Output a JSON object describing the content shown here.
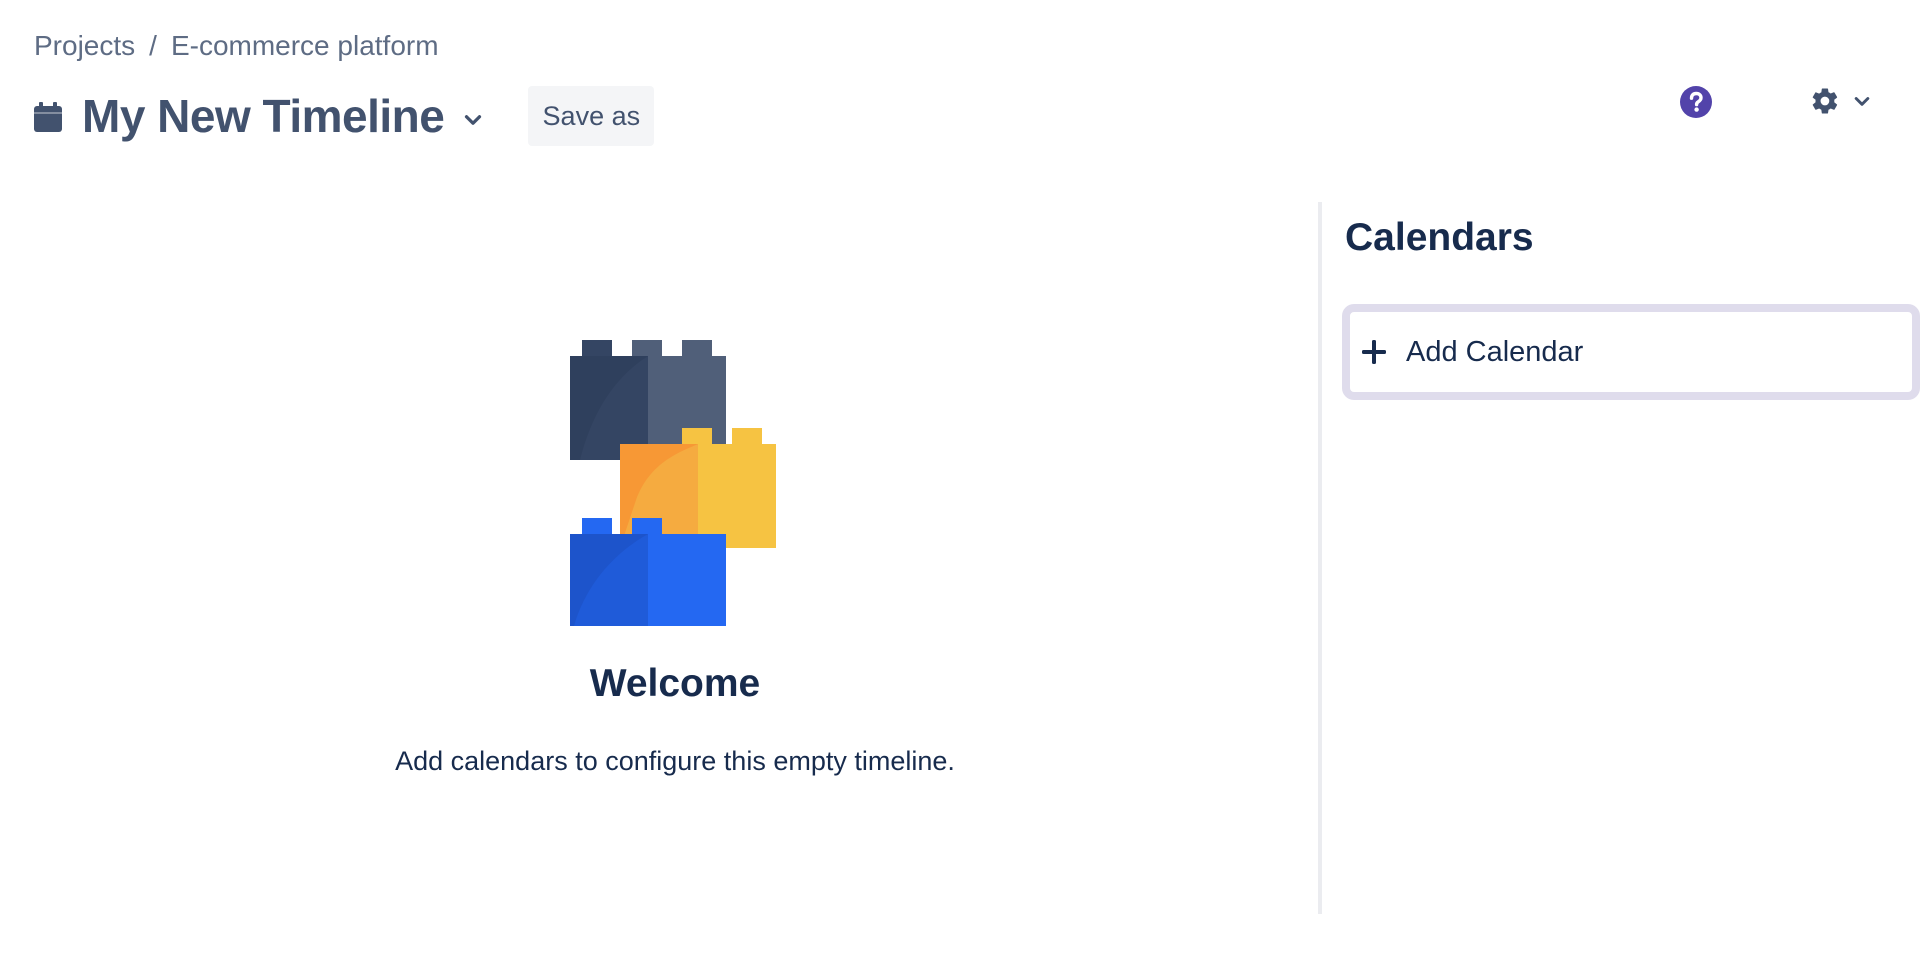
{
  "breadcrumb": {
    "items": [
      "Projects",
      "E-commerce platform"
    ],
    "separator": "/"
  },
  "header": {
    "title": "My New Timeline",
    "save_as_label": "Save as",
    "icons": {
      "title": "calendar-icon",
      "title_dropdown": "chevron-down-icon",
      "help": "help-icon",
      "settings": "gear-icon",
      "settings_dropdown": "chevron-down-icon"
    }
  },
  "main": {
    "illustration": "building-blocks-illustration",
    "welcome_title": "Welcome",
    "description": "Add calendars to configure this empty timeline."
  },
  "sidebar": {
    "title": "Calendars",
    "add_calendar_label": "Add Calendar",
    "add_icon": "plus-icon"
  },
  "colors": {
    "heading": "#172b4d",
    "subtle_text": "#5e6c84",
    "title_text": "#42526e",
    "help_accent": "#5243aa",
    "focus_ring": "#dfdcec",
    "block_dark": "#344563",
    "block_orange": "#f79232",
    "block_yellow": "#f6c342",
    "block_blue": "#2468f2"
  }
}
